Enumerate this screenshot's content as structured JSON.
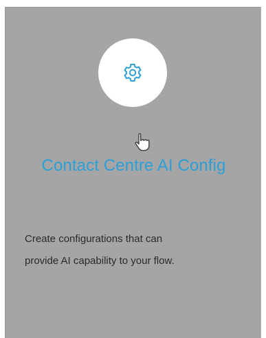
{
  "card": {
    "title": "Contact Centre AI Config",
    "description_lines": [
      "Create configurations that can",
      "provide AI capability to your flow."
    ],
    "icon": "gear-icon",
    "pointer": "hand-pointer-cursor",
    "colors": {
      "card_background": "#a5a5a5",
      "title": "#2c9fd6",
      "icon": "#2c9fd6",
      "icon_circle": "#ffffff",
      "description": "#2a2a2a"
    }
  }
}
